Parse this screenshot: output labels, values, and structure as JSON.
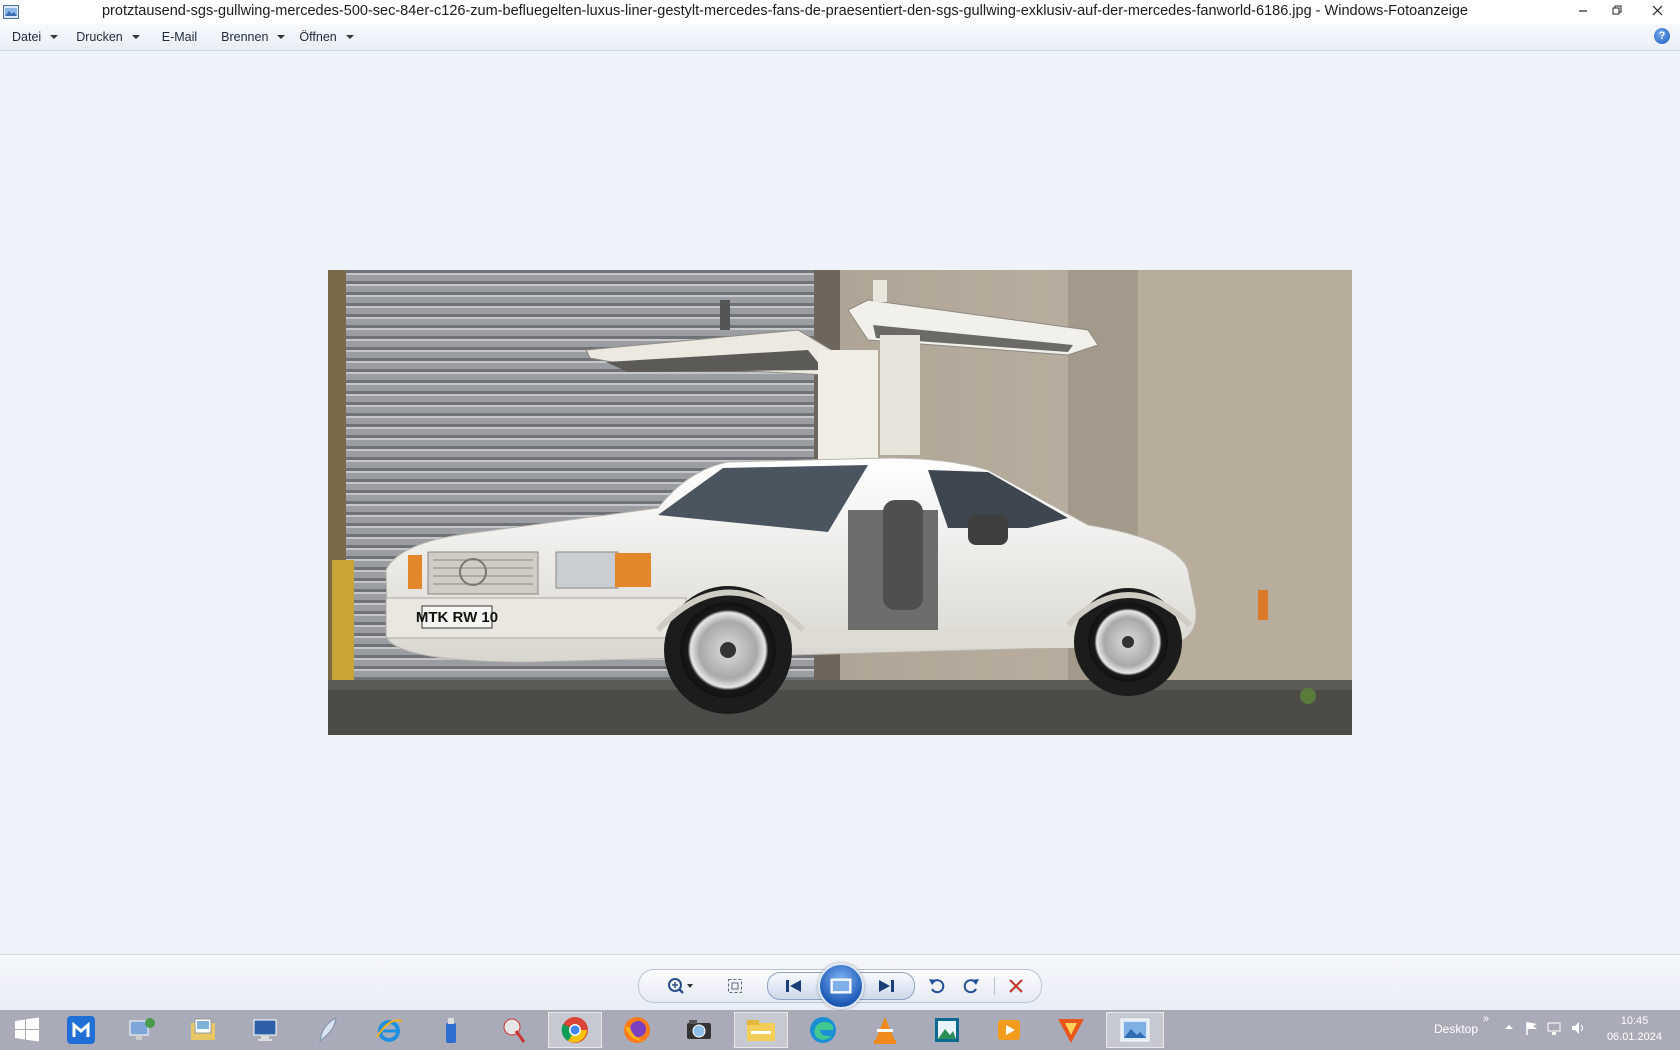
{
  "window": {
    "title": "protztausend-sgs-gullwing-mercedes-500-sec-84er-c126-zum-befluegelten-luxus-liner-gestylt-mercedes-fans-de-praesentiert-den-sgs-gullwing-exklusiv-auf-der-mercedes-fanworld-6186.jpg - Windows-Fotoanzeige",
    "app_icon": "photo-viewer-icon",
    "buttons": [
      "minimize-icon",
      "restore-icon",
      "close-icon"
    ]
  },
  "menu": {
    "datei": "Datei",
    "drucken": "Drucken",
    "email": "E-Mail",
    "brennen": "Brennen",
    "oeffnen": "Öffnen",
    "help_icon": "help-icon",
    "help_glyph": "?"
  },
  "photo": {
    "plate": "MTK RW 10",
    "colors": {
      "car": "#f1efe8",
      "wall": "#b3a898",
      "shutter": "#8f9296",
      "ground": "#5c5a55"
    }
  },
  "controls": {
    "icons": [
      "zoom-icon",
      "actual-size-icon",
      "previous-icon",
      "slideshow-icon",
      "next-icon",
      "rotate-left-icon",
      "rotate-right-icon",
      "delete-icon"
    ],
    "delete_color": "#c0392b"
  },
  "taskbar": {
    "icons": [
      "windows-start-icon",
      "maxthon-icon",
      "network-computer-icon",
      "folder-image-icon",
      "computer-icon",
      "feather-icon",
      "internet-explorer-icon",
      "usb-drive-icon",
      "paint-tool-icon",
      "chrome-icon",
      "firefox-icon",
      "camera-icon",
      "file-explorer-icon",
      "edge-icon",
      "vlc-icon",
      "image-viewer-icon",
      "media-player-icon",
      "vivaldi-icon",
      "photo-viewer-task-icon"
    ],
    "desktop_label": "Desktop",
    "chevron": "»",
    "time": "10:45",
    "date": "06.01.2024"
  }
}
